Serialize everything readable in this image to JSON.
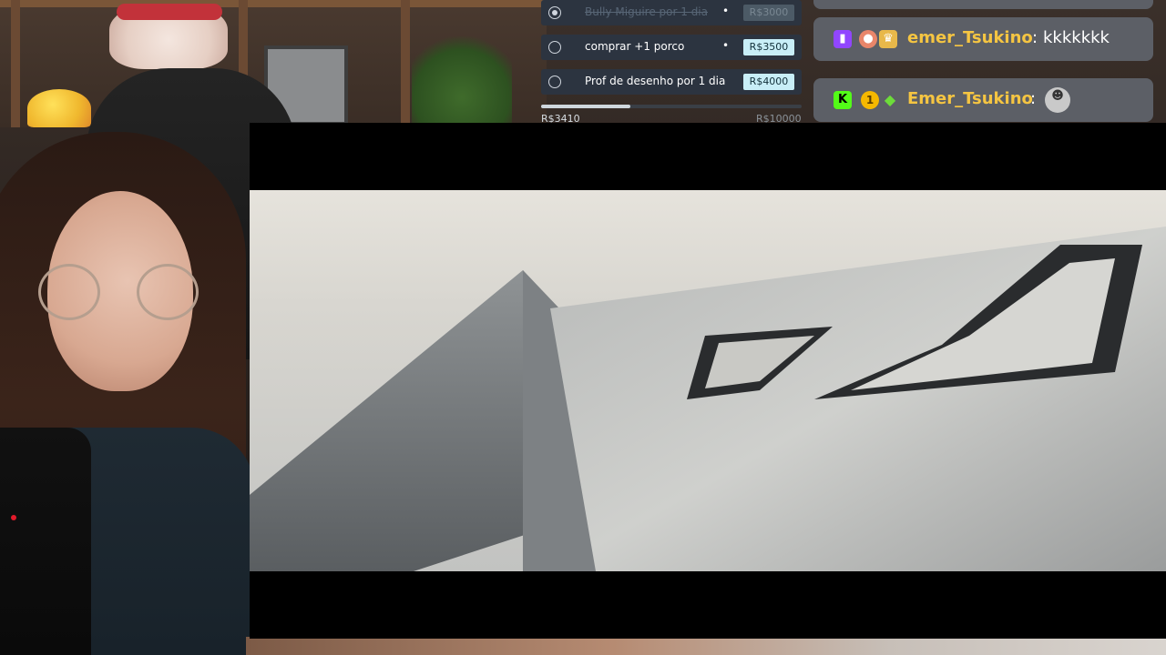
{
  "goals": [
    {
      "label": "Bully Miguire por 1 dia",
      "price": "R$3000",
      "completed": true
    },
    {
      "label": "comprar +1 porco",
      "price": "R$3500",
      "completed": false
    },
    {
      "label": "Prof de desenho por 1 dia",
      "price": "R$4000",
      "completed": false
    }
  ],
  "progress": {
    "current": "R$3410",
    "max": "R$10000",
    "fraction": 0.341
  },
  "chat": [
    {
      "platform": "twitch",
      "badges": [
        "peach-icon",
        "crown-icon"
      ],
      "username": "emer_Tsukino",
      "message": "kkkkkkk"
    },
    {
      "platform": "kick",
      "badges": [
        "level-1-icon",
        "green-gem-icon"
      ],
      "username": "Emer_Tsukino",
      "message": "",
      "emote": "sticker-emote"
    }
  ],
  "colors": {
    "username": "#f5c542",
    "price_tag": "#c8eef7",
    "twitch": "#9146ff",
    "kick": "#53fc18",
    "goal_bg": "#2c3440",
    "chat_bg": "#5c5f66"
  }
}
